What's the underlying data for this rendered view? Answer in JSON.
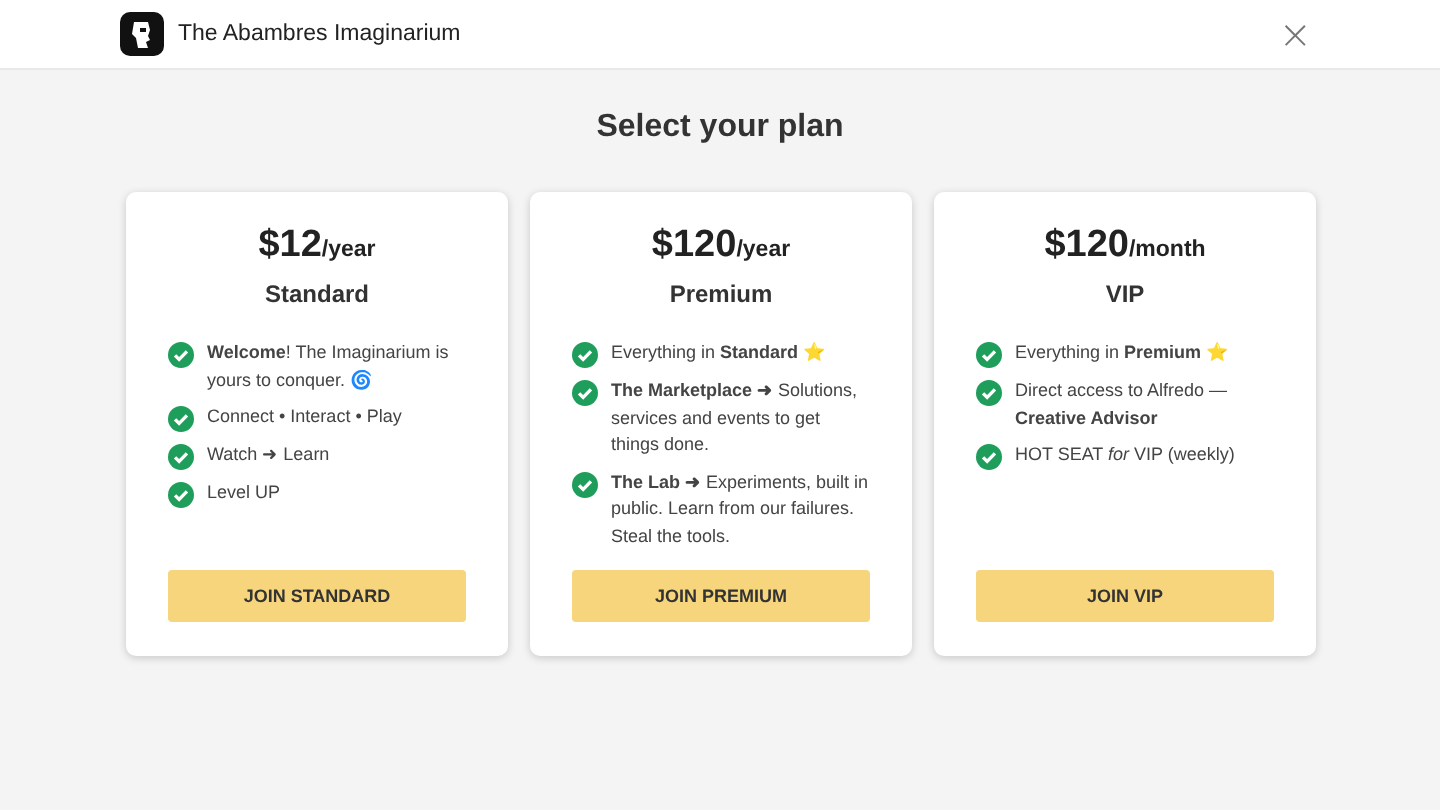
{
  "header": {
    "brand": "The Abambres Imaginarium",
    "close": "×"
  },
  "title": "Select your plan",
  "plans": [
    {
      "price": "$12",
      "period": "/year",
      "name": "Standard",
      "features": [
        "**Welcome**! The Imaginarium is yours to conquer. 🌀",
        "Connect • Interact • Play",
        "Watch ➜ Learn",
        "Level UP"
      ],
      "button": "JOIN STANDARD"
    },
    {
      "price": "$120",
      "period": "/year",
      "name": "Premium",
      "features": [
        "Everything in **Standard** ⭐",
        "**The Marketplace ➜** Solutions, services and events to get things done.",
        "**The Lab ➜** Experiments, built in public. Learn from our failures. Steal the tools."
      ],
      "button": "JOIN PREMIUM"
    },
    {
      "price": "$120",
      "period": "/month",
      "name": "VIP",
      "features": [
        "Everything in **Premium** ⭐",
        "Direct access to Alfredo — **Creative Advisor**",
        "HOT SEAT *for* VIP (weekly)"
      ],
      "button": "JOIN VIP"
    }
  ]
}
